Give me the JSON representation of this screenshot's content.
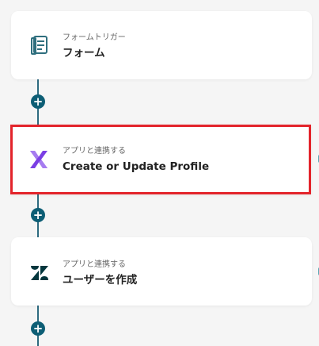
{
  "flow": {
    "steps": [
      {
        "subtitle": "フォームトリガー",
        "title": "フォーム",
        "icon": "form-document-icon"
      },
      {
        "subtitle": "アプリと連携する",
        "title": "Create or Update Profile",
        "icon": "klaviyo-x-icon"
      },
      {
        "subtitle": "アプリと連携する",
        "title": "ユーザーを作成",
        "icon": "zendesk-logo-icon"
      }
    ],
    "add_button_symbol": "+"
  },
  "colors": {
    "connector": "#2e6b80",
    "add_button": "#0d5e75",
    "selected_border": "#e3242b",
    "klaviyo_purple": "#7b3fe4",
    "zendesk_dark": "#03363d",
    "form_icon_teal": "#2f6f7e"
  }
}
